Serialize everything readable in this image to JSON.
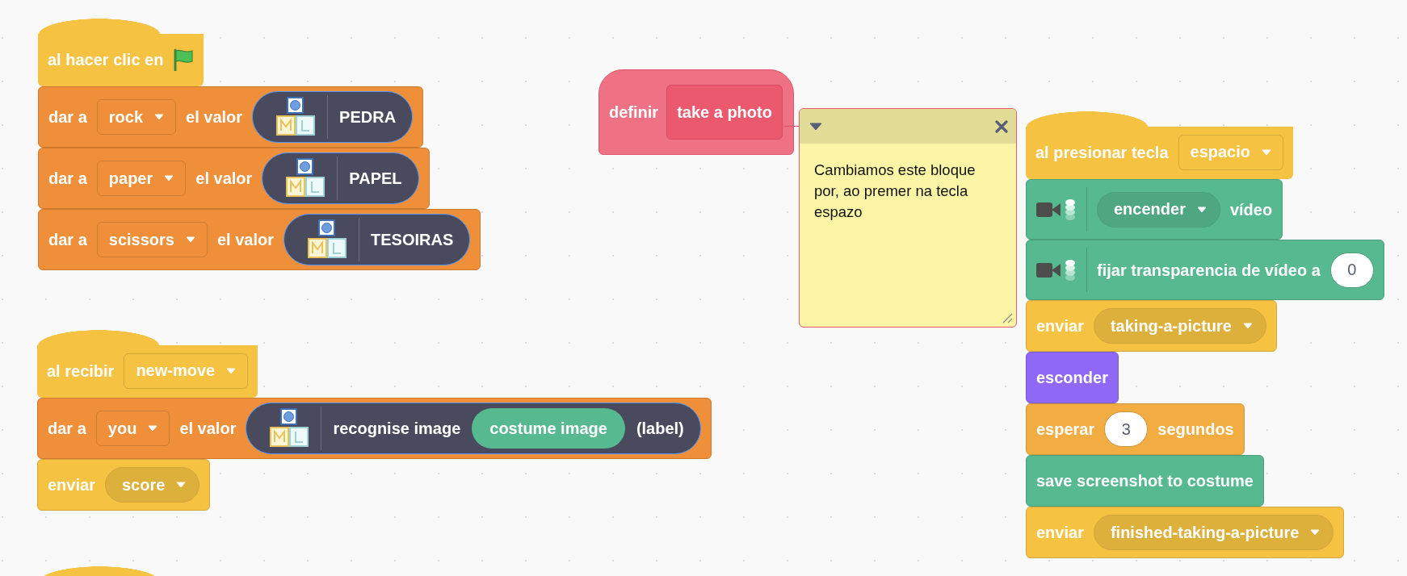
{
  "scripts": [
    {
      "blocks": [
        {
          "kind": "hat",
          "color": "#f5c242",
          "parts": [
            {
              "kind": "text",
              "text": "al hacer clic en"
            },
            {
              "kind": "flag"
            }
          ]
        },
        {
          "kind": "stack",
          "color": "#ef8f3a",
          "parts": [
            {
              "kind": "text",
              "text": "dar a"
            },
            {
              "kind": "field",
              "text": "rock"
            },
            {
              "kind": "text",
              "text": "el valor"
            },
            {
              "kind": "ml",
              "parts": [
                {
                  "kind": "text",
                  "text": "PEDRA"
                }
              ]
            }
          ]
        },
        {
          "kind": "stack",
          "color": "#ef8f3a",
          "parts": [
            {
              "kind": "text",
              "text": "dar a"
            },
            {
              "kind": "field",
              "text": "paper"
            },
            {
              "kind": "text",
              "text": "el valor"
            },
            {
              "kind": "ml",
              "parts": [
                {
                  "kind": "text",
                  "text": "PAPEL"
                }
              ]
            }
          ]
        },
        {
          "kind": "stack",
          "color": "#ef8f3a",
          "parts": [
            {
              "kind": "text",
              "text": "dar a"
            },
            {
              "kind": "field",
              "text": "scissors"
            },
            {
              "kind": "text",
              "text": "el valor"
            },
            {
              "kind": "ml",
              "parts": [
                {
                  "kind": "text",
                  "text": "TESOIRAS"
                }
              ]
            }
          ]
        }
      ]
    },
    {
      "blocks": [
        {
          "kind": "hat",
          "color": "#f5c242",
          "parts": [
            {
              "kind": "text",
              "text": "al recibir"
            },
            {
              "kind": "field",
              "text": "new-move"
            }
          ]
        },
        {
          "kind": "stack",
          "color": "#ef8f3a",
          "parts": [
            {
              "kind": "text",
              "text": "dar a"
            },
            {
              "kind": "field",
              "text": "you"
            },
            {
              "kind": "text",
              "text": "el valor"
            },
            {
              "kind": "ml",
              "parts": [
                {
                  "kind": "text",
                  "text": "recognise image"
                },
                {
                  "kind": "reporter",
                  "text": "costume image"
                },
                {
                  "kind": "text",
                  "text": "(label)"
                }
              ]
            }
          ]
        },
        {
          "kind": "stack",
          "color": "#f5c242",
          "parts": [
            {
              "kind": "text",
              "text": "enviar"
            },
            {
              "kind": "pill",
              "text": "score"
            }
          ]
        }
      ]
    },
    {
      "blocks": [
        {
          "kind": "hat",
          "color": "#f5c242"
        }
      ]
    },
    {
      "blocks": [
        {
          "kind": "hat",
          "color": "#f5c242",
          "parts": [
            {
              "kind": "text",
              "text": "al presionar tecla"
            },
            {
              "kind": "field",
              "text": "espacio"
            }
          ]
        },
        {
          "kind": "stack",
          "color": "#57b98f",
          "parts": [
            {
              "kind": "video"
            },
            {
              "kind": "pill",
              "text": "encender"
            },
            {
              "kind": "text",
              "text": "vídeo"
            }
          ]
        },
        {
          "kind": "stack",
          "color": "#57b98f",
          "parts": [
            {
              "kind": "video"
            },
            {
              "kind": "text",
              "text": "fijar transparencia de vídeo a"
            },
            {
              "kind": "number",
              "text": "0"
            }
          ]
        },
        {
          "kind": "stack",
          "color": "#f5c242",
          "parts": [
            {
              "kind": "text",
              "text": "enviar"
            },
            {
              "kind": "pill",
              "text": "taking-a-picture"
            }
          ]
        },
        {
          "kind": "stack",
          "color": "#8f68f5",
          "parts": [
            {
              "kind": "text",
              "text": "esconder"
            }
          ]
        },
        {
          "kind": "stack",
          "color": "#f2ad42",
          "parts": [
            {
              "kind": "text",
              "text": "esperar"
            },
            {
              "kind": "number",
              "text": "3"
            },
            {
              "kind": "text",
              "text": "segundos"
            }
          ]
        },
        {
          "kind": "stack",
          "color": "#57b98f",
          "parts": [
            {
              "kind": "text",
              "text": "save screenshot to costume"
            }
          ]
        },
        {
          "kind": "stack",
          "color": "#f5c242",
          "parts": [
            {
              "kind": "text",
              "text": "enviar"
            },
            {
              "kind": "pill",
              "text": "finished-taking-a-picture"
            }
          ]
        }
      ]
    }
  ],
  "definition": {
    "label": "definir",
    "name": "take a photo"
  },
  "comment": {
    "text": "Cambiamos este bloque por, ao premer na tecla espazo",
    "collapsed": false
  }
}
